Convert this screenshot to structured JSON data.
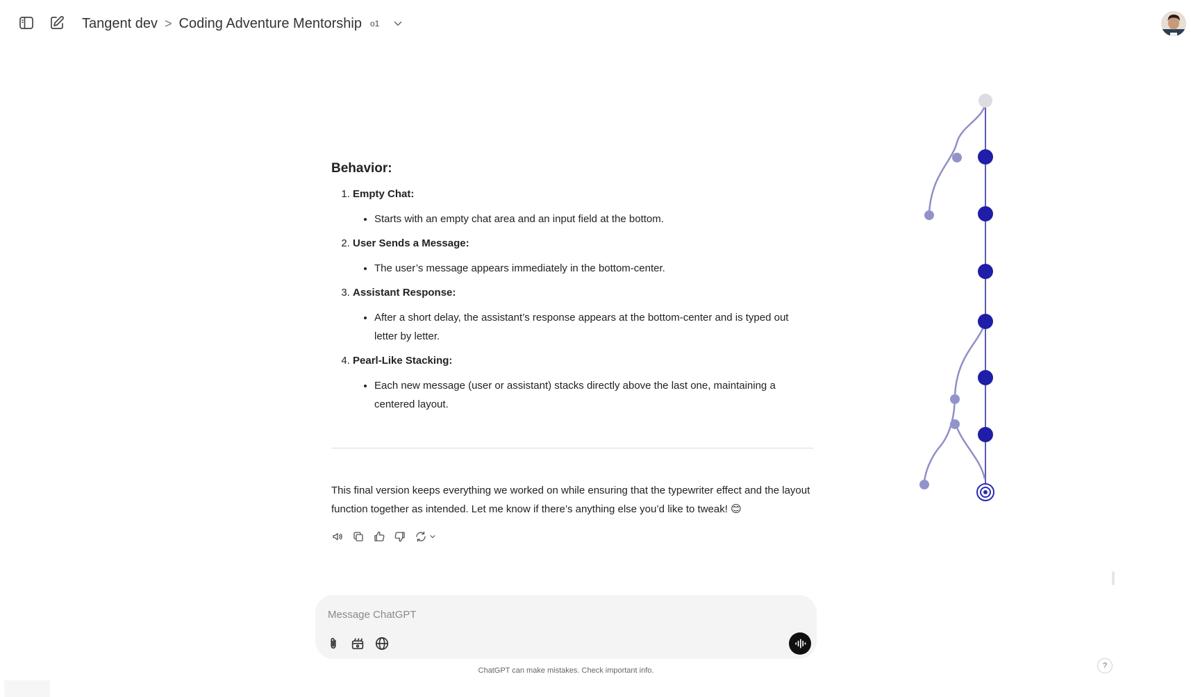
{
  "header": {
    "workspace": "Tangent dev",
    "separator": ">",
    "conversation_title": "Coding Adventure Mentorship",
    "model_badge": "o1"
  },
  "content": {
    "section_title": "Behavior:",
    "items": [
      {
        "title": "Empty Chat:",
        "bullet": "Starts with an empty chat area and an input field at the bottom."
      },
      {
        "title": "User Sends a Message:",
        "bullet": "The user’s message appears immediately in the bottom-center."
      },
      {
        "title": "Assistant Response:",
        "bullet": "After a short delay, the assistant’s response appears at the bottom-center and is typed out letter by letter."
      },
      {
        "title": "Pearl-Like Stacking:",
        "bullet": "Each new message (user or assistant) stacks directly above the last one, maintaining a centered layout."
      }
    ],
    "closing_text": "This final version keeps everything we worked on while ensuring that the typewriter effect and the layout function together as intended. Let me know if there’s anything else you’d like to tweak! 😊"
  },
  "actions": [
    "read-aloud-icon",
    "copy-icon",
    "thumbs-up-icon",
    "thumbs-down-icon",
    "regenerate-icon"
  ],
  "composer": {
    "placeholder": "Message ChatGPT",
    "value": "",
    "tools": [
      "paperclip-icon",
      "tools-icon",
      "globe-icon"
    ]
  },
  "disclaimer": "ChatGPT can make mistakes. Check important info.",
  "help_label": "?",
  "colors": {
    "tree_main": "#1e1ea8",
    "tree_branch": "#8f8fc9",
    "tree_root": "#d9d9e0",
    "composer_bg": "#f4f4f4",
    "voice_button": "#111111"
  }
}
